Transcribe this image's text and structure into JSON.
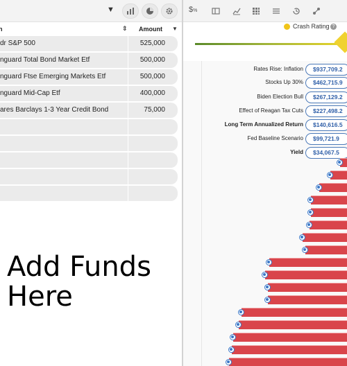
{
  "portfolio": {
    "columns": {
      "name": "n",
      "amount": "Amount"
    },
    "rows": [
      {
        "name": "dr S&P 500",
        "amount": "525,000"
      },
      {
        "name": "nguard Total Bond Market Etf",
        "amount": "500,000"
      },
      {
        "name": "nguard Ftse Emerging Markets Etf",
        "amount": "500,000"
      },
      {
        "name": "nguard Mid-Cap Etf",
        "amount": "400,000"
      },
      {
        "name": "ares Barclays 1-3 Year Credit Bond",
        "amount": "75,000"
      },
      {
        "name": "",
        "amount": ""
      },
      {
        "name": "",
        "amount": ""
      },
      {
        "name": "",
        "amount": ""
      },
      {
        "name": "",
        "amount": ""
      },
      {
        "name": "",
        "amount": ""
      }
    ],
    "caption_line1": "Add Funds",
    "caption_line2": "Here"
  },
  "toolbar_icons": [
    "bar-chart-icon",
    "pie-chart-icon",
    "gear-icon"
  ],
  "right_toolbar_icons": [
    "dollar-percent-icon",
    "panel-icon",
    "line-chart-icon",
    "grid-icon",
    "list-icon",
    "history-icon",
    "share-icon"
  ],
  "crash": {
    "label": "Crash Rating",
    "help": "?"
  },
  "scenarios": [
    {
      "label": "Rates Rise: Inflation",
      "value": "$937,709.2",
      "bold": false
    },
    {
      "label": "Stocks Up 30%",
      "value": "$462,715.9",
      "bold": false
    },
    {
      "label": "Biden Election Bull",
      "value": "$267,129.2",
      "bold": false
    },
    {
      "label": "Effect of Reagan Tax Cuts",
      "value": "$227,498.2",
      "bold": false
    },
    {
      "label": "Long Term Annualized Return",
      "value": "$140,616.5",
      "bold": true
    },
    {
      "label": "Fed Baseline Scenario",
      "value": "$99,721.9",
      "bold": false
    },
    {
      "label": "Yield",
      "value": "$34,067.5",
      "bold": true
    }
  ],
  "colors": {
    "bar": "#d9454b",
    "dot": "#3a78c8",
    "accent": "#4b79b8"
  }
}
